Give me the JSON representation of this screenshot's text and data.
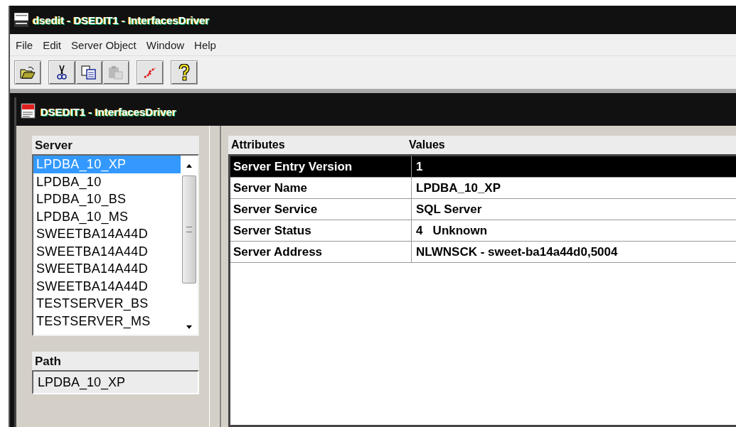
{
  "window": {
    "title": "dsedit - DSEDIT1 - InterfacesDriver"
  },
  "menu": [
    "File",
    "Edit",
    "Server Object",
    "Window",
    "Help"
  ],
  "toolbar": [
    {
      "kind": "open",
      "disabled": false
    },
    {
      "kind": "cut",
      "disabled": false
    },
    {
      "kind": "copy",
      "disabled": false
    },
    {
      "kind": "paste",
      "disabled": true
    },
    {
      "kind": "ping",
      "disabled": false
    },
    {
      "kind": "help",
      "disabled": false
    }
  ],
  "document": {
    "title": "DSEDIT1 - InterfacesDriver"
  },
  "server_list": {
    "label": "Server",
    "items": [
      {
        "name": "LPDBA_10_XP",
        "selected": true
      },
      {
        "name": "LPDBA_10",
        "selected": false
      },
      {
        "name": "LPDBA_10_BS",
        "selected": false
      },
      {
        "name": "LPDBA_10_MS",
        "selected": false
      },
      {
        "name": "SWEETBA14A44D",
        "selected": false
      },
      {
        "name": "SWEETBA14A44D",
        "selected": false
      },
      {
        "name": "SWEETBA14A44D",
        "selected": false
      },
      {
        "name": "SWEETBA14A44D",
        "selected": false
      },
      {
        "name": "TESTSERVER_BS",
        "selected": false
      },
      {
        "name": "TESTSERVER_MS",
        "selected": false
      }
    ]
  },
  "path": {
    "label": "Path",
    "value": "LPDBA_10_XP"
  },
  "table": {
    "columns": [
      "Attributes",
      "Values"
    ],
    "rows": [
      {
        "attribute": "Server Entry Version",
        "value": "1",
        "selected": true
      },
      {
        "attribute": "Server Name",
        "value": "LPDBA_10_XP",
        "selected": false
      },
      {
        "attribute": "Server Service",
        "value": "SQL Server",
        "selected": false
      },
      {
        "attribute": "Server Status",
        "value": "4   Unknown",
        "selected": false
      },
      {
        "attribute": "Server Address",
        "value": "NLWNSCK - sweet-ba14a44d0,5004",
        "selected": false
      }
    ]
  }
}
